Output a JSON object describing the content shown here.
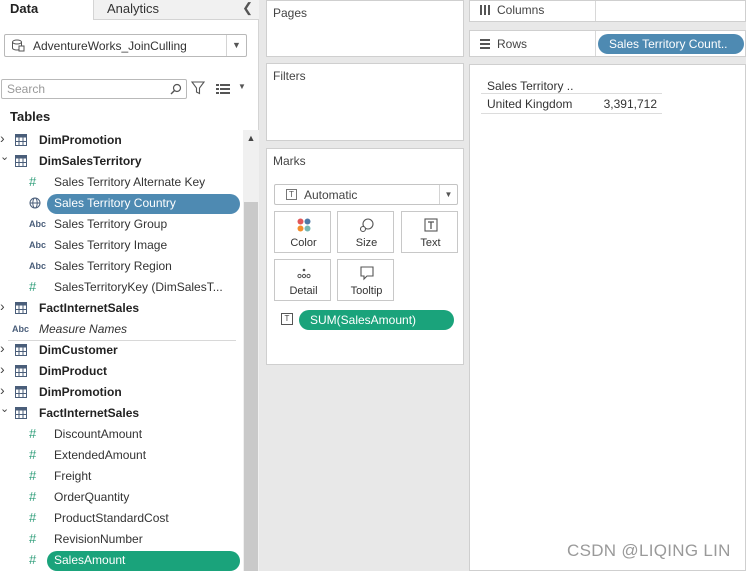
{
  "tabs": {
    "data": "Data",
    "analytics": "Analytics"
  },
  "datasource": {
    "name": "AdventureWorks_JoinCulling"
  },
  "search": {
    "placeholder": "Search"
  },
  "tables_heading": "Tables",
  "tree": [
    {
      "kind": "table",
      "label": "DimPromotion",
      "expanded": false
    },
    {
      "kind": "table",
      "label": "DimSalesTerritory",
      "expanded": true
    },
    {
      "kind": "field",
      "type": "number",
      "label": "Sales Territory Alternate Key"
    },
    {
      "kind": "field",
      "type": "geo",
      "label": "Sales Territory Country",
      "selected": true
    },
    {
      "kind": "field",
      "type": "string",
      "label": "Sales Territory Group"
    },
    {
      "kind": "field",
      "type": "string",
      "label": "Sales Territory Image"
    },
    {
      "kind": "field",
      "type": "string",
      "label": "Sales Territory Region"
    },
    {
      "kind": "field",
      "type": "number",
      "label": "SalesTerritoryKey (DimSalesT..."
    },
    {
      "kind": "table",
      "label": "FactInternetSales",
      "expanded": false
    },
    {
      "kind": "measure-names",
      "type": "string",
      "label": "Measure Names"
    },
    {
      "kind": "table",
      "label": "DimCustomer",
      "expanded": false
    },
    {
      "kind": "table",
      "label": "DimProduct",
      "expanded": false
    },
    {
      "kind": "table",
      "label": "DimPromotion",
      "expanded": false
    },
    {
      "kind": "table",
      "label": "FactInternetSales",
      "expanded": true
    },
    {
      "kind": "field",
      "type": "number",
      "label": "DiscountAmount"
    },
    {
      "kind": "field",
      "type": "number",
      "label": "ExtendedAmount"
    },
    {
      "kind": "field",
      "type": "number",
      "label": "Freight"
    },
    {
      "kind": "field",
      "type": "number",
      "label": "OrderQuantity"
    },
    {
      "kind": "field",
      "type": "number",
      "label": "ProductStandardCost"
    },
    {
      "kind": "field",
      "type": "number",
      "label": "RevisionNumber"
    },
    {
      "kind": "field",
      "type": "number",
      "label": "SalesAmount",
      "in_use": true
    }
  ],
  "pages": {
    "title": "Pages"
  },
  "filters": {
    "title": "Filters"
  },
  "marks": {
    "title": "Marks",
    "type": "Automatic",
    "buttons": {
      "color": "Color",
      "size": "Size",
      "text": "Text",
      "detail": "Detail",
      "tooltip": "Tooltip"
    },
    "text_field": "SUM(SalesAmount)"
  },
  "columns": {
    "label": "Columns"
  },
  "rows": {
    "label": "Rows",
    "pill": "Sales Territory Count.."
  },
  "view": {
    "header": "Sales Territory ..",
    "row_label": "United Kingdom",
    "row_value": "3,391,712"
  },
  "watermark": "CSDN @LIQING LIN",
  "colors": {
    "dimension_pill": "#4e8ab2",
    "measure_pill": "#1aa37b"
  }
}
